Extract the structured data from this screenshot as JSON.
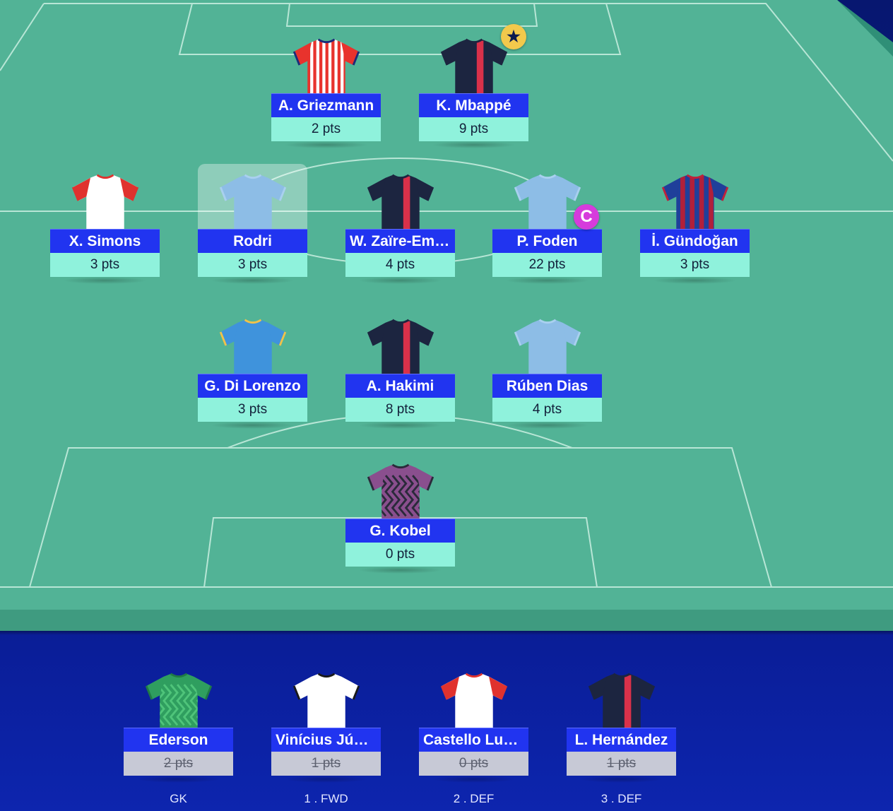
{
  "colors": {
    "pitch": "#52b396",
    "pitch_line": "#b8e6d6",
    "name_bar": "#2134f0",
    "points_bar": "#8ff2dc",
    "bench_points_bar": "#c7c9d6",
    "vice_badge": "#f2c94c",
    "captain_badge": "#d63bdc",
    "background": "#0a1f9a"
  },
  "starting": {
    "forwards": [
      {
        "name": "A. Griezmann",
        "points": "2 pts",
        "shirt": "atletico-shirt-icon"
      },
      {
        "name": "K. Mbappé",
        "points": "9 pts",
        "shirt": "psg-shirt-icon",
        "badge": "★",
        "badge_icon": "vice-captain-star-icon"
      }
    ],
    "midfielders": [
      {
        "name": "X. Simons",
        "points": "3 pts",
        "shirt": "leipzig-shirt-icon"
      },
      {
        "name": "Rodri",
        "points": "3 pts",
        "shirt": "man-city-shirt-icon",
        "selected": true
      },
      {
        "name": "W. Zaïre-Emery",
        "points": "4 pts",
        "shirt": "psg-shirt-icon"
      },
      {
        "name": "P. Foden",
        "points": "22 pts",
        "shirt": "man-city-shirt-icon",
        "badge": "C",
        "badge_icon": "captain-icon"
      },
      {
        "name": "İ. Gündoğan",
        "points": "3 pts",
        "shirt": "barcelona-shirt-icon"
      }
    ],
    "defenders": [
      {
        "name": "G. Di Lorenzo",
        "points": "3 pts",
        "shirt": "napoli-shirt-icon"
      },
      {
        "name": "A. Hakimi",
        "points": "8 pts",
        "shirt": "psg-shirt-icon"
      },
      {
        "name": "Rúben Dias",
        "points": "4 pts",
        "shirt": "man-city-shirt-icon"
      }
    ],
    "goalkeeper": [
      {
        "name": "G. Kobel",
        "points": "0 pts",
        "shirt": "dortmund-gk-shirt-icon"
      }
    ]
  },
  "bench": [
    {
      "name": "Ederson",
      "points": "2 pts",
      "label": "GK",
      "shirt": "man-city-gk-shirt-icon"
    },
    {
      "name": "Vinícius Júnior",
      "points": "1 pts",
      "label": "1 . FWD",
      "shirt": "real-madrid-shirt-icon"
    },
    {
      "name": "Castello Lukeba",
      "points": "0 pts",
      "label": "2 . DEF",
      "shirt": "leipzig-shirt-icon"
    },
    {
      "name": "L. Hernández",
      "points": "1 pts",
      "label": "3 . DEF",
      "shirt": "psg-shirt-icon"
    }
  ]
}
